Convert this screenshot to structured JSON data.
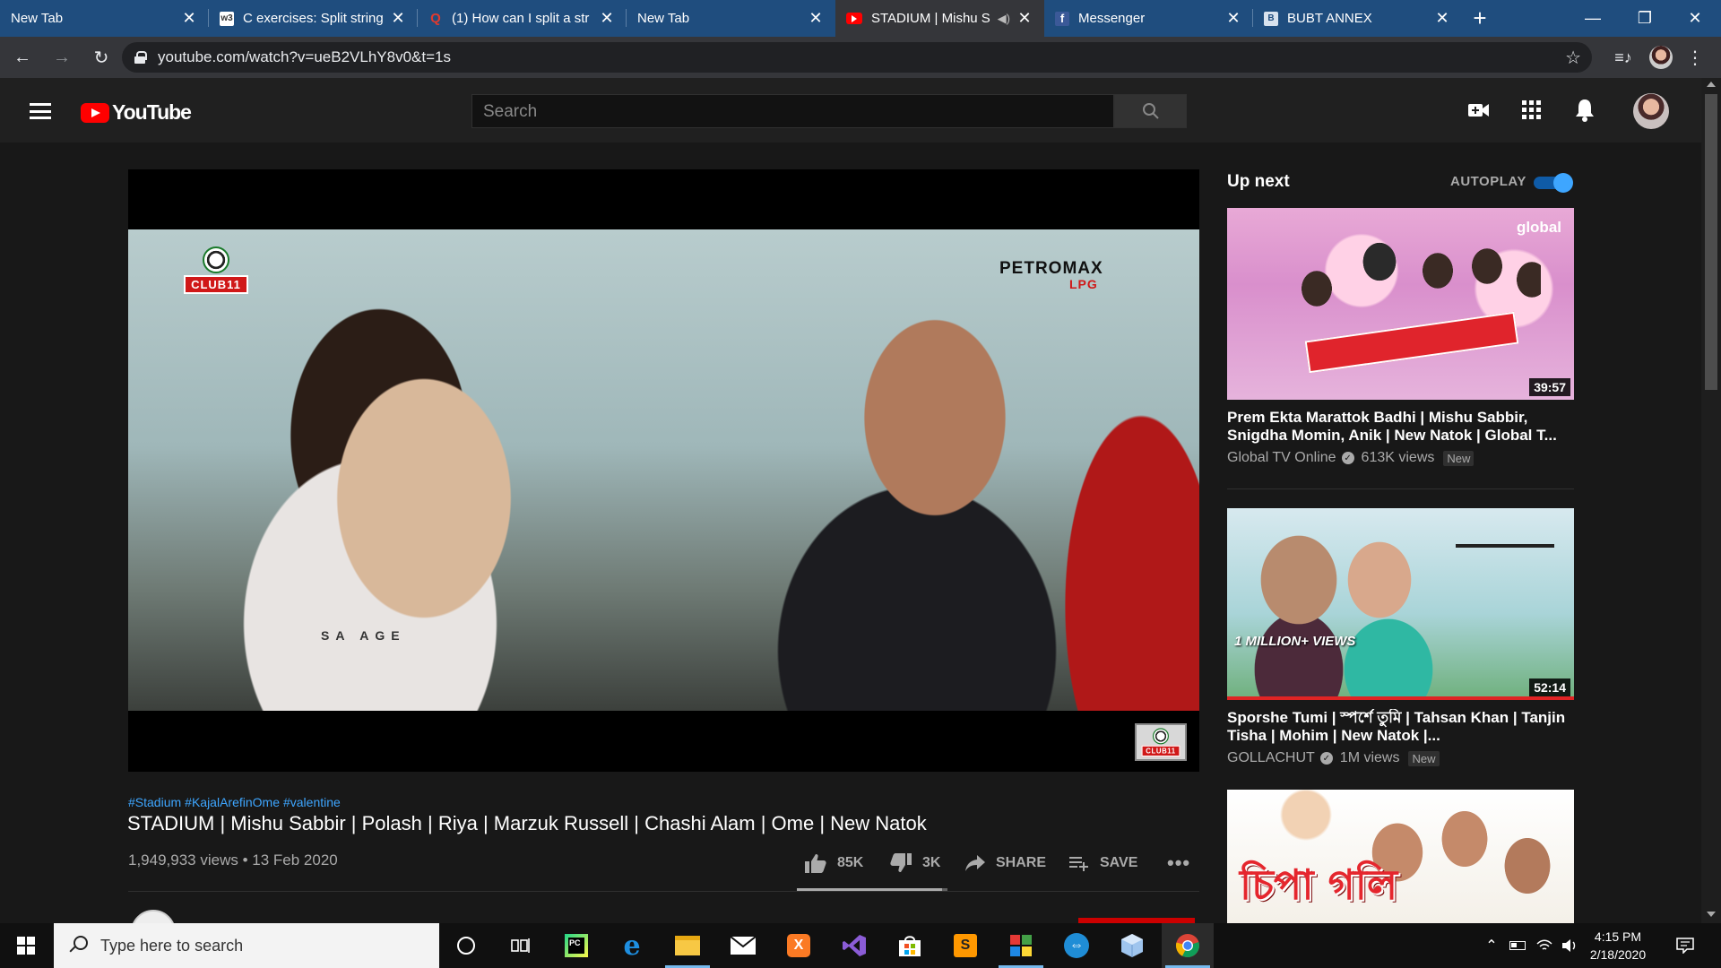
{
  "browser": {
    "tabs": [
      {
        "title": "New Tab",
        "favicon": "none"
      },
      {
        "title": "C exercises: Split string",
        "favicon": "w3resource-icon"
      },
      {
        "title": "(1) How can I split a str",
        "favicon": "quora-icon"
      },
      {
        "title": "New Tab",
        "favicon": "none"
      },
      {
        "title": "STADIUM | Mishu S",
        "favicon": "youtube-icon"
      },
      {
        "title": "Messenger",
        "favicon": "facebook-icon"
      },
      {
        "title": "BUBT ANNEX",
        "favicon": "bubt-icon"
      }
    ],
    "active_tab": 4,
    "url": "youtube.com/watch?v=ueB2VLhY8v0&t=1s"
  },
  "youtube": {
    "logo_text": "YouTube",
    "search_placeholder": "Search"
  },
  "video": {
    "overlay_brand": "PETROMAX",
    "overlay_brand_sub": "LPG",
    "club_logo_text": "CLUB11",
    "shirt_text": "SA  AGE",
    "hashtags": [
      "#Stadium",
      "#KajalArefinOme",
      "#valentine"
    ],
    "title": "STADIUM | Mishu Sabbir | Polash | Riya | Marzuk Russell | Chashi Alam | Ome | New Natok",
    "views_date": "1,949,933 views • 13 Feb 2020",
    "likes": "85K",
    "dislikes": "3K",
    "like_ratio": 0.966,
    "share_label": "SHARE",
    "save_label": "SAVE"
  },
  "sidebar": {
    "heading": "Up next",
    "autoplay_label": "AUTOPLAY",
    "autoplay_on": true,
    "cards": [
      {
        "title": "Prem Ekta Marattok Badhi | Mishu Sabbir, Snigdha Momin, Anik | New Natok | Global T...",
        "channel": "Global TV Online",
        "views": "613K views",
        "badge": "New",
        "duration": "39:57",
        "thumb_text": "global"
      },
      {
        "title": "Sporshe Tumi | স্পর্শে তুমি | Tahsan Khan | Tanjin Tisha | Mohim | New Natok |...",
        "channel": "GOLLACHUT",
        "views": "1M views",
        "badge": "New",
        "duration": "52:14",
        "thumb_text": "1 MILLION+ VIEWS"
      },
      {
        "title": "",
        "thumb_text": "চিপা গলি"
      }
    ]
  },
  "taskbar": {
    "search_placeholder": "Type here to search",
    "time": "4:15 PM",
    "date": "2/18/2020"
  }
}
